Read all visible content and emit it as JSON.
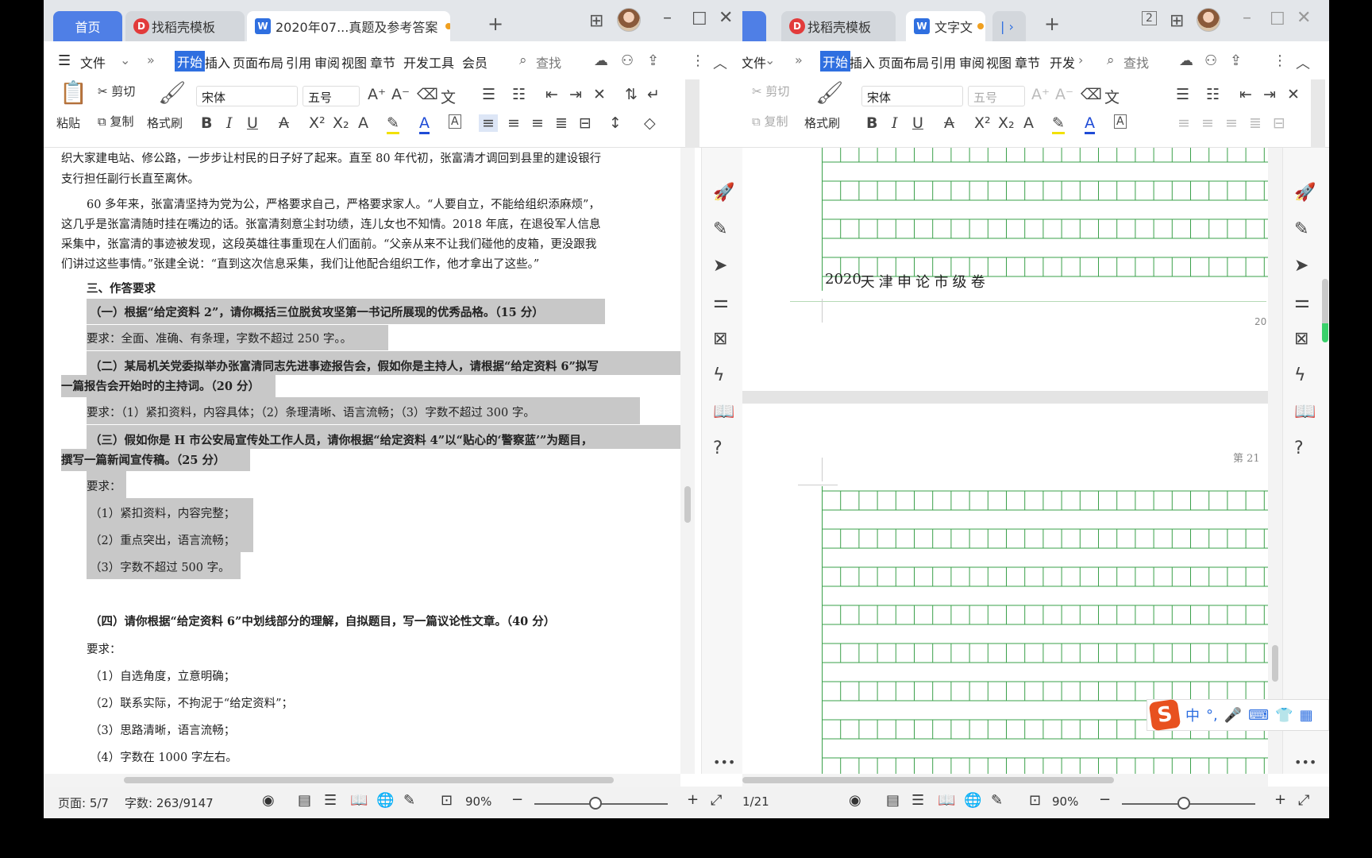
{
  "left": {
    "tabs": {
      "home": "首页",
      "template": "找稻壳模板",
      "doc": "2020年07...真题及参考答案",
      "new": "+"
    },
    "menu": {
      "file": "文件",
      "start": "开始",
      "items": [
        "插入",
        "页面布局",
        "引用",
        "审阅",
        "视图",
        "章节",
        "开发工具",
        "会员"
      ],
      "search": "查找"
    },
    "ribbon": {
      "paste": "粘贴",
      "cut": "剪切",
      "copy": "复制",
      "format_painter": "格式刷",
      "font": "宋体",
      "size": "五号"
    },
    "doc_lines": [
      "织大家建电站、修公路，一步步让村民的日子好了起来。直至 80 年代初，张富清才调回到县里的建设银行",
      "支行担任副行长直至离休。",
      "60 多年来，张富清坚持为党为公，严格要求自己，严格要求家人。“人要自立，不能给组织添麻烦”，",
      "这几乎是张富清随时挂在嘴边的话。张富清刻意尘封功绩，连儿女也不知情。2018 年底，在退役军人信息",
      "采集中，张富清的事迹被发现，这段英雄往事重现在人们面前。“父亲从来不让我们碰他的皮箱，更没跟我",
      "们讲过这些事情。”张建全说：“直到这次信息采集，我们让他配合组织工作，他才拿出了这些。”",
      "三、作答要求",
      "（一）根据“给定资料 2”，请你概括三位脱贫攻坚第一书记所展现的优秀品格。（15 分）",
      "要求：全面、准确、有条理，字数不超过 250 字。。",
      "（二）某局机关党委拟举办张富清同志先进事迹报告会，假如你是主持人，请根据“给定资料 6”拟写",
      "一篇报告会开始时的主持词。（20 分）",
      "要求：（1）紧扣资料，内容具体；（2）条理清晰、语言流畅；（3）字数不超过 300 字。",
      "（三）假如你是 H 市公安局宣传处工作人员，请你根据“给定资料 4”以“贴心的‘警察蓝’”为题目，",
      "撰写一篇新闻宣传稿。（25 分）",
      "要求：",
      "（1）紧扣资料，内容完整；",
      "（2）重点突出，语言流畅；",
      "（3）字数不超过 500 字。",
      "（四）请你根据“给定资料 6”中划线部分的理解，自拟题目，写一篇议论性文章。（40 分）",
      "要求：",
      "（1）自选角度，立意明确；",
      "（2）联系实际，不拘泥于“给定资料”；",
      "（3）思路清晰，语言流畅；",
      "（4）字数在 1000 字左右。"
    ],
    "status": {
      "page": "页面: 5/7",
      "words": "字数: 263/9147",
      "zoom": "90%"
    }
  },
  "right": {
    "tabs": {
      "template": "找稻壳模板",
      "doc": "文字文",
      "new": "+",
      "badge": "2"
    },
    "menu": {
      "file": "文件",
      "start": "开始",
      "items": [
        "插入",
        "页面布局",
        "引用",
        "审阅",
        "视图",
        "章节",
        "开发"
      ],
      "search": "查找"
    },
    "ribbon": {
      "cut": "剪切",
      "copy": "复制",
      "format_painter": "格式刷",
      "font": "宋体",
      "size": "五号"
    },
    "grid_title_chars": [
      "2020",
      "天",
      "津",
      "申",
      "论",
      "市",
      "级",
      "卷"
    ],
    "page_num_partial": "20",
    "page_label_partial": "第 21",
    "status": {
      "page": "1/21",
      "zoom": "90%"
    }
  },
  "ime": {
    "mode": "中",
    "punct": "°,"
  }
}
